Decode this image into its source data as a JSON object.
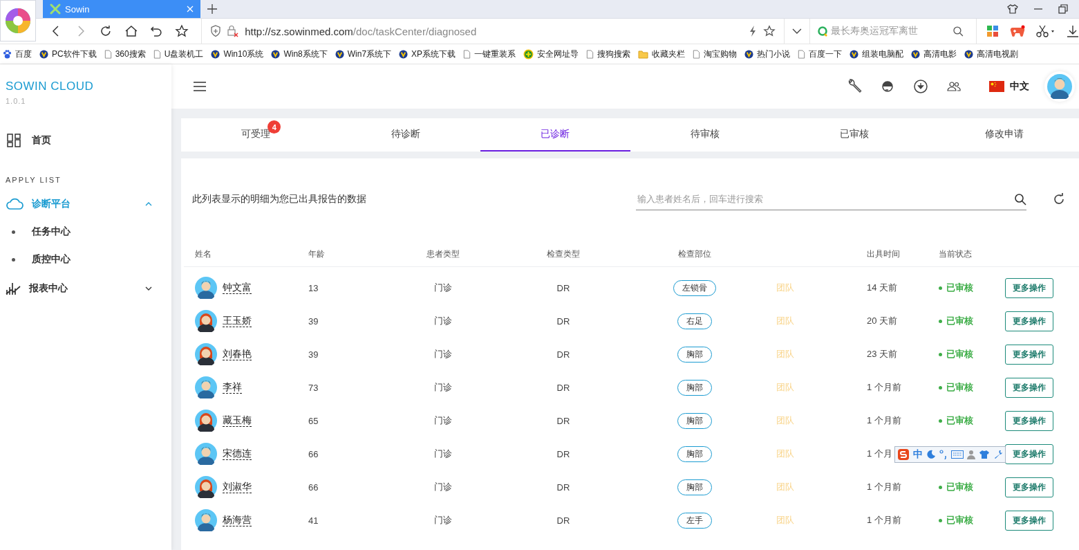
{
  "browser": {
    "tab_title": "Sowin",
    "url_host": "http://sz.sowinmed.com",
    "url_path": "/doc/taskCenter/diagnosed",
    "search_placeholder": "最长寿奥运冠军离世",
    "bookmarks": [
      {
        "label": "百度",
        "kind": "paw"
      },
      {
        "label": "PC软件下载",
        "kind": "site"
      },
      {
        "label": "360搜索",
        "kind": "page"
      },
      {
        "label": "U盘装机工",
        "kind": "page"
      },
      {
        "label": "Win10系统",
        "kind": "site"
      },
      {
        "label": "Win8系统下",
        "kind": "site"
      },
      {
        "label": "Win7系统下",
        "kind": "site"
      },
      {
        "label": "XP系统下载",
        "kind": "site"
      },
      {
        "label": "一键重装系",
        "kind": "page"
      },
      {
        "label": "安全网址导",
        "kind": "safe"
      },
      {
        "label": "搜狗搜索",
        "kind": "page"
      },
      {
        "label": "收藏夹栏",
        "kind": "folder"
      },
      {
        "label": "淘宝购物",
        "kind": "page"
      },
      {
        "label": "热门小说",
        "kind": "site"
      },
      {
        "label": "百度一下",
        "kind": "page"
      },
      {
        "label": "组装电脑配",
        "kind": "site"
      },
      {
        "label": "高清电影",
        "kind": "site"
      },
      {
        "label": "高清电视剧",
        "kind": "site"
      }
    ]
  },
  "sidebar": {
    "brand": "SOWIN CLOUD",
    "version": "1.0.1",
    "section": "APPLY LIST",
    "home": {
      "label": "首页",
      "selected": false
    },
    "groups": [
      {
        "label": "诊断平台",
        "kind": "cloud",
        "selected": true,
        "expanded": true,
        "children": [
          {
            "label": "任务中心"
          },
          {
            "label": "质控中心"
          }
        ]
      },
      {
        "label": "报表中心",
        "kind": "chart",
        "selected": false,
        "expanded": false
      }
    ]
  },
  "header": {
    "language": "中文"
  },
  "tabs": [
    {
      "label": "可受理",
      "selected": false,
      "badge": "4"
    },
    {
      "label": "待诊断",
      "selected": false
    },
    {
      "label": "已诊断",
      "selected": true
    },
    {
      "label": "待审核",
      "selected": false
    },
    {
      "label": "已审核",
      "selected": false
    },
    {
      "label": "修改申请",
      "selected": false
    }
  ],
  "content": {
    "description": "此列表显示的明细为您已出具报告的数据",
    "search_placeholder": "输入患者姓名后，回车进行搜索",
    "columns": [
      "姓名",
      "年龄",
      "患者类型",
      "检查类型",
      "检查部位",
      "出具时间",
      "当前状态"
    ],
    "rows": [
      {
        "name": "钟文富",
        "kind": "male",
        "age": "13",
        "patient_type": "门诊",
        "exam_type": "DR",
        "body_part": "左锁骨",
        "team": "团队",
        "time": "14 天前",
        "status": "已审核",
        "action": "更多操作"
      },
      {
        "name": "王玉娇",
        "kind": "female",
        "age": "39",
        "patient_type": "门诊",
        "exam_type": "DR",
        "body_part": "右足",
        "team": "团队",
        "time": "20 天前",
        "status": "已审核",
        "action": "更多操作"
      },
      {
        "name": "刘春艳",
        "kind": "female",
        "age": "39",
        "patient_type": "门诊",
        "exam_type": "DR",
        "body_part": "胸部",
        "team": "团队",
        "time": "23 天前",
        "status": "已审核",
        "action": "更多操作"
      },
      {
        "name": "李祥",
        "kind": "male",
        "age": "73",
        "patient_type": "门诊",
        "exam_type": "DR",
        "body_part": "胸部",
        "team": "团队",
        "time": "1 个月前",
        "status": "已审核",
        "action": "更多操作"
      },
      {
        "name": "藏玉梅",
        "kind": "female",
        "age": "65",
        "patient_type": "门诊",
        "exam_type": "DR",
        "body_part": "胸部",
        "team": "团队",
        "time": "1 个月前",
        "status": "已审核",
        "action": "更多操作"
      },
      {
        "name": "宋德连",
        "kind": "male",
        "age": "66",
        "patient_type": "门诊",
        "exam_type": "DR",
        "body_part": "胸部",
        "team": "团队",
        "time": "1 个月",
        "action": "更多操作"
      },
      {
        "name": "刘淑华",
        "kind": "female",
        "age": "66",
        "patient_type": "门诊",
        "exam_type": "DR",
        "body_part": "胸部",
        "team": "团队",
        "time": "1 个月前",
        "status": "已审核",
        "action": "更多操作"
      },
      {
        "name": "杨海营",
        "kind": "male",
        "age": "41",
        "patient_type": "门诊",
        "exam_type": "DR",
        "body_part": "左手",
        "team": "团队",
        "time": "1 个月前",
        "status": "已审核",
        "action": "更多操作"
      }
    ]
  },
  "ime_toolbar": {
    "mode": "中"
  }
}
